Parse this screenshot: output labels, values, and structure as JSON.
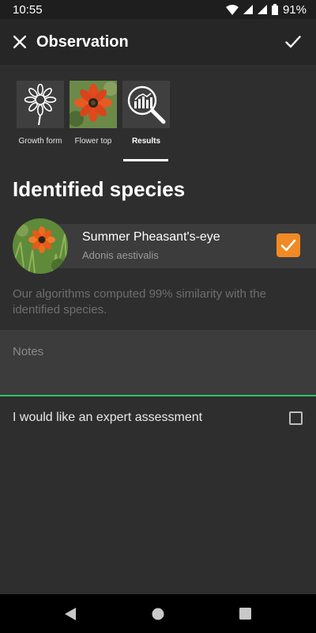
{
  "status_bar": {
    "time": "10:55",
    "battery_percent": "91%",
    "icons": [
      "wifi-icon",
      "signal-icon",
      "signal-icon",
      "battery-icon"
    ]
  },
  "toolbar": {
    "title": "Observation",
    "close_icon": "close-icon",
    "confirm_icon": "check-icon"
  },
  "tabs": [
    {
      "label": "Growth form",
      "icon": "flower-outline-icon",
      "active": false
    },
    {
      "label": "Flower top",
      "icon": "flower-photo",
      "active": false
    },
    {
      "label": "Results",
      "icon": "search-chart-icon",
      "active": true
    }
  ],
  "result": {
    "heading": "Identified species",
    "species": {
      "common_name": "Summer Pheasant's-eye",
      "latin_name": "Adonis aestivalis",
      "selected": true
    },
    "similarity_text": "Our algorithms computed 99% similarity with the identified species."
  },
  "notes": {
    "placeholder": "Notes",
    "value": ""
  },
  "expert": {
    "label": "I would like an expert assessment",
    "checked": false
  },
  "colors": {
    "accent_check": "#f08a24",
    "notes_underline": "#2ec262",
    "background": "#2e2e2e"
  },
  "nav_bar": {
    "icons": [
      "back-icon",
      "home-icon",
      "recents-icon"
    ]
  }
}
